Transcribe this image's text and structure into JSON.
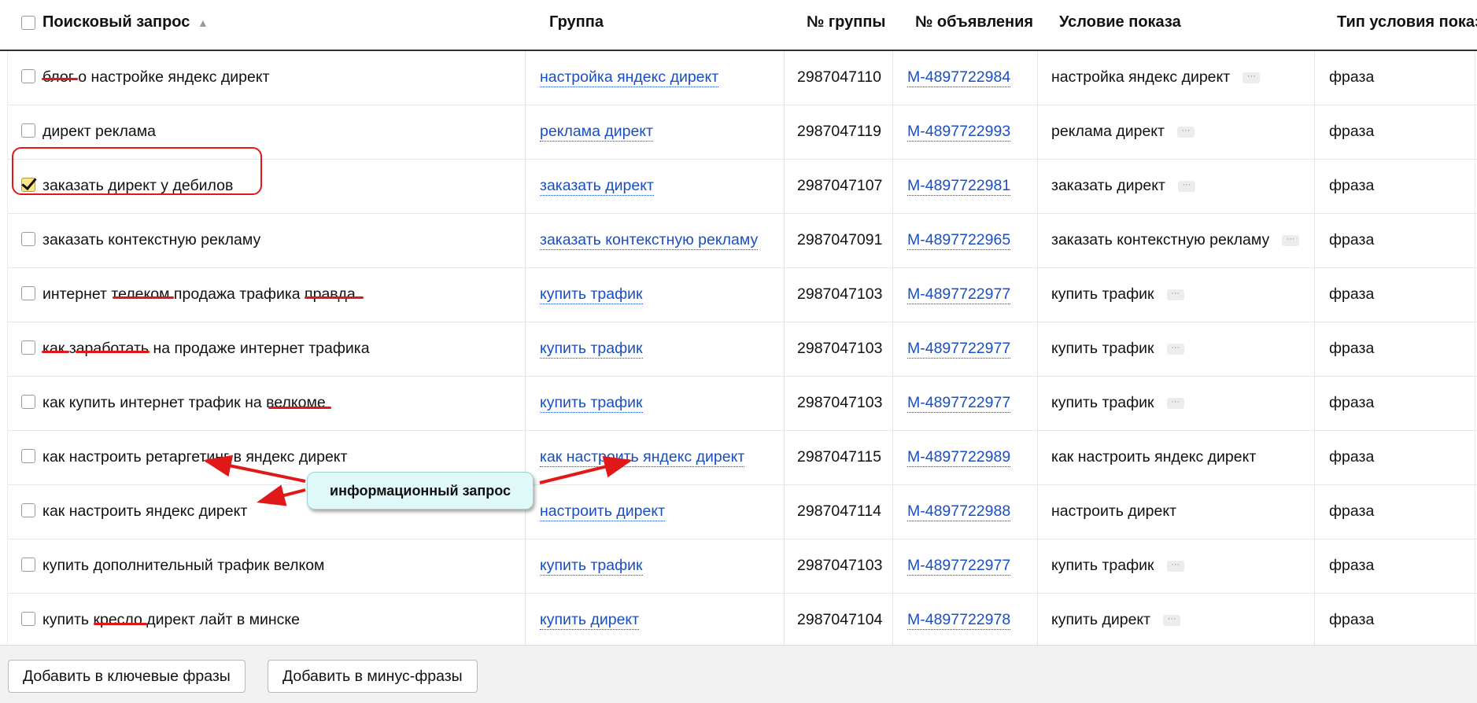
{
  "columns": {
    "query": "Поисковый запрос",
    "sort_indicator": "▲",
    "group": "Группа",
    "group_id": "№ группы",
    "ad_id": "№ объявления",
    "condition": "Условие показа",
    "condition_type": "Тип условия показа"
  },
  "rows": [
    {
      "query": "блог о настройке яндекс директ",
      "group": "настройка яндекс директ",
      "group_id": "2987047110",
      "ad_id": "M-4897722984",
      "condition": "настройка яндекс директ",
      "condition_more": true,
      "type": "фраза",
      "checked": false
    },
    {
      "query": "директ реклама",
      "group": "реклама директ",
      "group_id": "2987047119",
      "ad_id": "M-4897722993",
      "condition": "реклама директ",
      "condition_more": true,
      "type": "фраза",
      "checked": false
    },
    {
      "query": "заказать директ у дебилов",
      "group": "заказать директ",
      "group_id": "2987047107",
      "ad_id": "M-4897722981",
      "condition": "заказать директ",
      "condition_more": true,
      "type": "фраза",
      "checked": true
    },
    {
      "query": "заказать контекстную рекламу",
      "group": "заказать контекстную рекламу",
      "group_id": "2987047091",
      "ad_id": "M-4897722965",
      "condition": "заказать контекстную рекламу",
      "condition_more": true,
      "type": "фраза",
      "checked": false
    },
    {
      "query": "интернет телеком продажа трафика правда",
      "group": "купить трафик",
      "group_id": "2987047103",
      "ad_id": "M-4897722977",
      "condition": "купить трафик",
      "condition_more": true,
      "type": "фраза",
      "checked": false
    },
    {
      "query": "как заработать на продаже интернет трафика",
      "group": "купить трафик",
      "group_id": "2987047103",
      "ad_id": "M-4897722977",
      "condition": "купить трафик",
      "condition_more": true,
      "type": "фраза",
      "checked": false
    },
    {
      "query": "как купить интернет трафик на велкоме",
      "group": "купить трафик",
      "group_id": "2987047103",
      "ad_id": "M-4897722977",
      "condition": "купить трафик",
      "condition_more": true,
      "type": "фраза",
      "checked": false
    },
    {
      "query": "как настроить ретаргетинг в яндекс директ",
      "group": "как настроить яндекс директ",
      "group_id": "2987047115",
      "ad_id": "M-4897722989",
      "condition": "как настроить яндекс директ",
      "condition_more": false,
      "type": "фраза",
      "checked": false
    },
    {
      "query": "как настроить яндекс директ",
      "group": "настроить директ",
      "group_id": "2987047114",
      "ad_id": "M-4897722988",
      "condition": "настроить директ",
      "condition_more": false,
      "type": "фраза",
      "checked": false
    },
    {
      "query": "купить дополнительный трафик велком",
      "group": "купить трафик",
      "group_id": "2987047103",
      "ad_id": "M-4897722977",
      "condition": "купить трафик",
      "condition_more": true,
      "type": "фраза",
      "checked": false
    },
    {
      "query": "купить кресло директ лайт в минске",
      "group": "купить директ",
      "group_id": "2987047104",
      "ad_id": "M-4897722978",
      "condition": "купить директ",
      "condition_more": true,
      "type": "фраза",
      "checked": false
    }
  ],
  "more_glyph": "···",
  "annotation": {
    "callout_text": "информационный запрос",
    "color": "#e01818"
  },
  "footer": {
    "add_keywords": "Добавить в ключевые фразы",
    "add_negative": "Добавить в минус-фразы"
  }
}
